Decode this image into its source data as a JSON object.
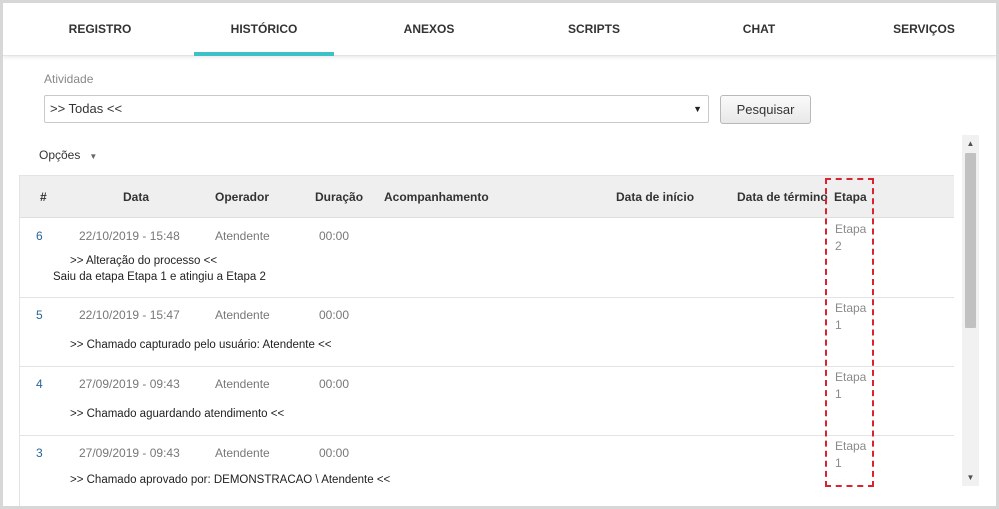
{
  "tabs": [
    {
      "label": "REGISTRO"
    },
    {
      "label": "HISTÓRICO"
    },
    {
      "label": "ANEXOS"
    },
    {
      "label": "SCRIPTS"
    },
    {
      "label": "CHAT"
    },
    {
      "label": "SERVIÇOS"
    }
  ],
  "active_tab": "HISTÓRICO",
  "accent_color": "#3ec0c7",
  "filter": {
    "label": "Atividade",
    "selected": ">> Todas <<",
    "search_label": "Pesquisar"
  },
  "options_label": "Opções",
  "table": {
    "headers": {
      "num": "#",
      "data": "Data",
      "operador": "Operador",
      "duracao": "Duração",
      "acompanhamento": "Acompanhamento",
      "data_inicio": "Data de início",
      "data_termino": "Data de término",
      "etapa": "Etapa"
    },
    "rows": [
      {
        "num": "6",
        "data": "22/10/2019 - 15:48",
        "operador": "Atendente",
        "duracao": "00:00",
        "etapa": "Etapa 2",
        "desc1": ">> Alteração do processo <<",
        "desc2": "Saiu da etapa Etapa 1 e atingiu a Etapa 2"
      },
      {
        "num": "5",
        "data": "22/10/2019 - 15:47",
        "operador": "Atendente",
        "duracao": "00:00",
        "etapa": "Etapa 1",
        "desc1": ">> Chamado capturado pelo usuário: Atendente <<"
      },
      {
        "num": "4",
        "data": "27/09/2019 - 09:43",
        "operador": "Atendente",
        "duracao": "00:00",
        "etapa": "Etapa 1",
        "desc1": ">> Chamado aguardando atendimento <<"
      },
      {
        "num": "3",
        "data": "27/09/2019 - 09:43",
        "operador": "Atendente",
        "duracao": "00:00",
        "etapa": "Etapa 1",
        "desc1": ">> Chamado aprovado por: DEMONSTRACAO \\ Atendente <<"
      }
    ]
  },
  "highlight_color": "#d9232e"
}
